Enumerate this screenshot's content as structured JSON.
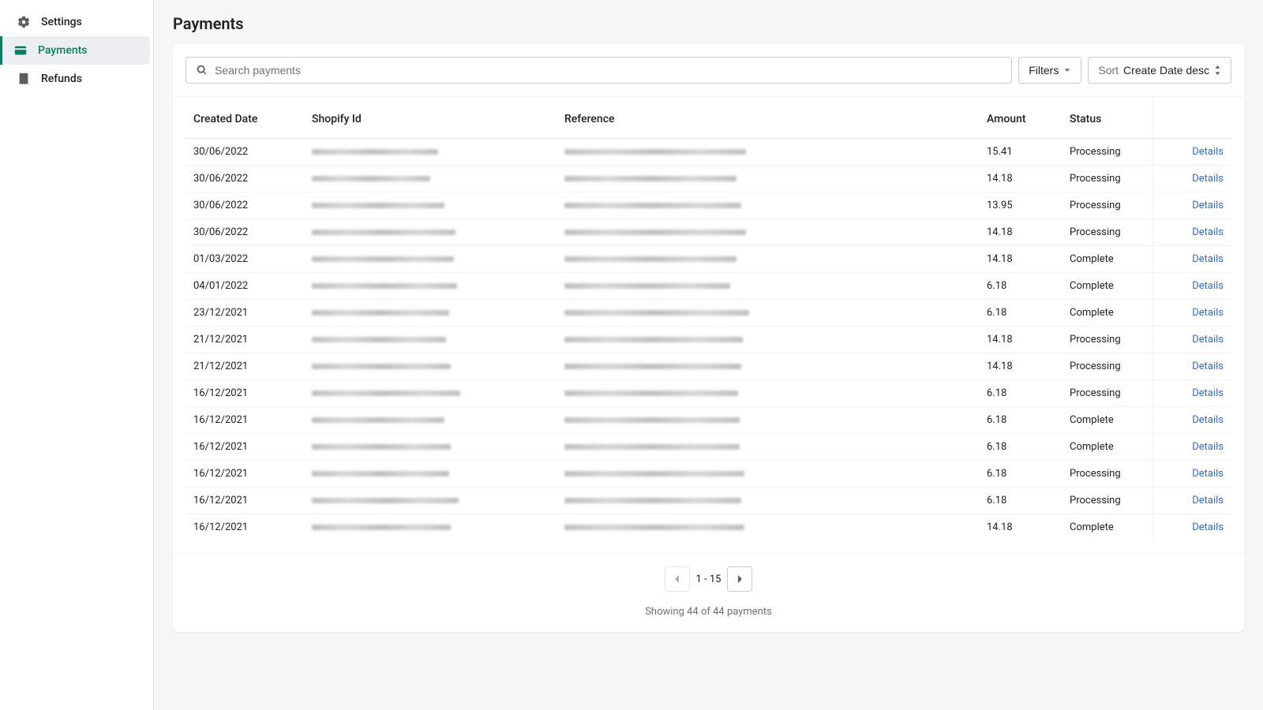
{
  "sidebar": {
    "items": [
      {
        "label": "Settings",
        "icon": "gear-icon",
        "active": false
      },
      {
        "label": "Payments",
        "icon": "card-icon",
        "active": true
      },
      {
        "label": "Refunds",
        "icon": "receipt-icon",
        "active": false
      }
    ]
  },
  "page": {
    "title": "Payments"
  },
  "toolbar": {
    "search_placeholder": "Search payments",
    "filters_label": "Filters",
    "sort_label": "Sort",
    "sort_value": "Create Date desc"
  },
  "table": {
    "columns": [
      "Created Date",
      "Shopify Id",
      "Reference",
      "Amount",
      "Status"
    ],
    "details_label": "Details",
    "rows": [
      {
        "date": "30/06/2022",
        "sid_w": 160,
        "ref_w": 230,
        "amount": "15.41",
        "status": "Processing"
      },
      {
        "date": "30/06/2022",
        "sid_w": 150,
        "ref_w": 218,
        "amount": "14.18",
        "status": "Processing"
      },
      {
        "date": "30/06/2022",
        "sid_w": 168,
        "ref_w": 224,
        "amount": "13.95",
        "status": "Processing"
      },
      {
        "date": "30/06/2022",
        "sid_w": 182,
        "ref_w": 230,
        "amount": "14.18",
        "status": "Processing"
      },
      {
        "date": "01/03/2022",
        "sid_w": 180,
        "ref_w": 218,
        "amount": "14.18",
        "status": "Complete"
      },
      {
        "date": "04/01/2022",
        "sid_w": 184,
        "ref_w": 210,
        "amount": "6.18",
        "status": "Complete"
      },
      {
        "date": "23/12/2021",
        "sid_w": 174,
        "ref_w": 234,
        "amount": "6.18",
        "status": "Complete"
      },
      {
        "date": "21/12/2021",
        "sid_w": 170,
        "ref_w": 226,
        "amount": "14.18",
        "status": "Processing"
      },
      {
        "date": "21/12/2021",
        "sid_w": 176,
        "ref_w": 224,
        "amount": "14.18",
        "status": "Processing"
      },
      {
        "date": "16/12/2021",
        "sid_w": 188,
        "ref_w": 220,
        "amount": "6.18",
        "status": "Processing"
      },
      {
        "date": "16/12/2021",
        "sid_w": 168,
        "ref_w": 222,
        "amount": "6.18",
        "status": "Complete"
      },
      {
        "date": "16/12/2021",
        "sid_w": 176,
        "ref_w": 222,
        "amount": "6.18",
        "status": "Complete"
      },
      {
        "date": "16/12/2021",
        "sid_w": 174,
        "ref_w": 228,
        "amount": "6.18",
        "status": "Processing"
      },
      {
        "date": "16/12/2021",
        "sid_w": 186,
        "ref_w": 224,
        "amount": "6.18",
        "status": "Processing"
      },
      {
        "date": "16/12/2021",
        "sid_w": 176,
        "ref_w": 228,
        "amount": "14.18",
        "status": "Complete"
      }
    ]
  },
  "pagination": {
    "range": "1 - 15",
    "summary": "Showing 44 of 44 payments"
  }
}
